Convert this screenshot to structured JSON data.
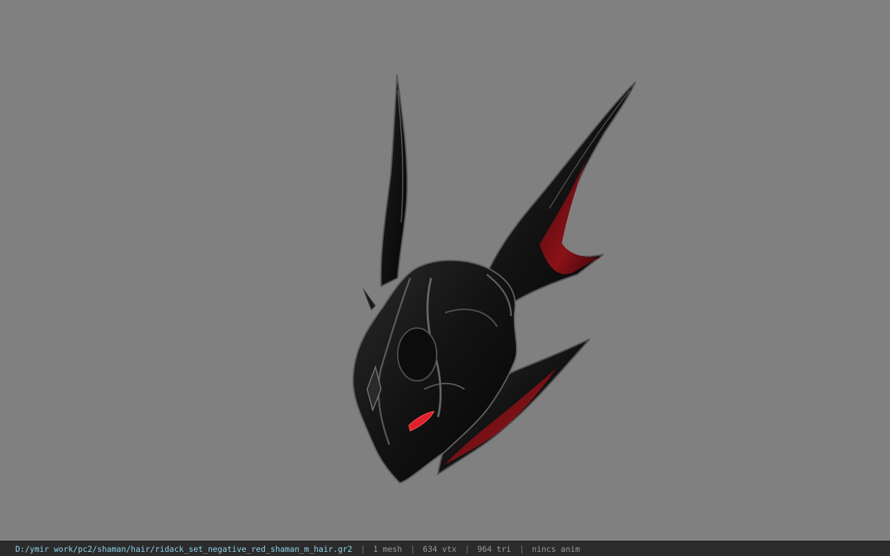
{
  "viewport": {
    "background_color": "#808080",
    "model_description_icon": "helmet-model",
    "model_colors": {
      "shell": "#141414",
      "highlight": "#6a6a6a",
      "inner_red": "#7a1016",
      "eye_glow": "#e0202a"
    }
  },
  "statusbar": {
    "file_path": "D:/ymir work/pc2/shaman/hair/ridack_set_negative_red_shaman_m_hair.gr2",
    "separator": "|",
    "mesh_count": "1 mesh",
    "vertex_count": "634 vtx",
    "triangle_count": "964 tri",
    "anim_status": "nincs anim",
    "path_color": "#8fd3ea",
    "text_color": "#9a9a9a"
  }
}
